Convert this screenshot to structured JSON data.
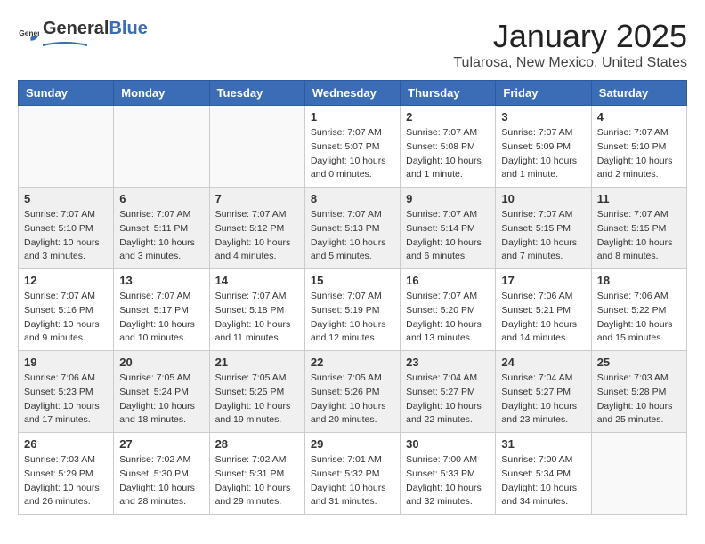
{
  "header": {
    "logo_general": "General",
    "logo_blue": "Blue",
    "month_title": "January 2025",
    "location": "Tularosa, New Mexico, United States"
  },
  "weekdays": [
    "Sunday",
    "Monday",
    "Tuesday",
    "Wednesday",
    "Thursday",
    "Friday",
    "Saturday"
  ],
  "weeks": [
    [
      {
        "day": "",
        "sunrise": "",
        "sunset": "",
        "daylight": ""
      },
      {
        "day": "",
        "sunrise": "",
        "sunset": "",
        "daylight": ""
      },
      {
        "day": "",
        "sunrise": "",
        "sunset": "",
        "daylight": ""
      },
      {
        "day": "1",
        "sunrise": "Sunrise: 7:07 AM",
        "sunset": "Sunset: 5:07 PM",
        "daylight": "Daylight: 10 hours and 0 minutes."
      },
      {
        "day": "2",
        "sunrise": "Sunrise: 7:07 AM",
        "sunset": "Sunset: 5:08 PM",
        "daylight": "Daylight: 10 hours and 1 minute."
      },
      {
        "day": "3",
        "sunrise": "Sunrise: 7:07 AM",
        "sunset": "Sunset: 5:09 PM",
        "daylight": "Daylight: 10 hours and 1 minute."
      },
      {
        "day": "4",
        "sunrise": "Sunrise: 7:07 AM",
        "sunset": "Sunset: 5:10 PM",
        "daylight": "Daylight: 10 hours and 2 minutes."
      }
    ],
    [
      {
        "day": "5",
        "sunrise": "Sunrise: 7:07 AM",
        "sunset": "Sunset: 5:10 PM",
        "daylight": "Daylight: 10 hours and 3 minutes."
      },
      {
        "day": "6",
        "sunrise": "Sunrise: 7:07 AM",
        "sunset": "Sunset: 5:11 PM",
        "daylight": "Daylight: 10 hours and 3 minutes."
      },
      {
        "day": "7",
        "sunrise": "Sunrise: 7:07 AM",
        "sunset": "Sunset: 5:12 PM",
        "daylight": "Daylight: 10 hours and 4 minutes."
      },
      {
        "day": "8",
        "sunrise": "Sunrise: 7:07 AM",
        "sunset": "Sunset: 5:13 PM",
        "daylight": "Daylight: 10 hours and 5 minutes."
      },
      {
        "day": "9",
        "sunrise": "Sunrise: 7:07 AM",
        "sunset": "Sunset: 5:14 PM",
        "daylight": "Daylight: 10 hours and 6 minutes."
      },
      {
        "day": "10",
        "sunrise": "Sunrise: 7:07 AM",
        "sunset": "Sunset: 5:15 PM",
        "daylight": "Daylight: 10 hours and 7 minutes."
      },
      {
        "day": "11",
        "sunrise": "Sunrise: 7:07 AM",
        "sunset": "Sunset: 5:15 PM",
        "daylight": "Daylight: 10 hours and 8 minutes."
      }
    ],
    [
      {
        "day": "12",
        "sunrise": "Sunrise: 7:07 AM",
        "sunset": "Sunset: 5:16 PM",
        "daylight": "Daylight: 10 hours and 9 minutes."
      },
      {
        "day": "13",
        "sunrise": "Sunrise: 7:07 AM",
        "sunset": "Sunset: 5:17 PM",
        "daylight": "Daylight: 10 hours and 10 minutes."
      },
      {
        "day": "14",
        "sunrise": "Sunrise: 7:07 AM",
        "sunset": "Sunset: 5:18 PM",
        "daylight": "Daylight: 10 hours and 11 minutes."
      },
      {
        "day": "15",
        "sunrise": "Sunrise: 7:07 AM",
        "sunset": "Sunset: 5:19 PM",
        "daylight": "Daylight: 10 hours and 12 minutes."
      },
      {
        "day": "16",
        "sunrise": "Sunrise: 7:07 AM",
        "sunset": "Sunset: 5:20 PM",
        "daylight": "Daylight: 10 hours and 13 minutes."
      },
      {
        "day": "17",
        "sunrise": "Sunrise: 7:06 AM",
        "sunset": "Sunset: 5:21 PM",
        "daylight": "Daylight: 10 hours and 14 minutes."
      },
      {
        "day": "18",
        "sunrise": "Sunrise: 7:06 AM",
        "sunset": "Sunset: 5:22 PM",
        "daylight": "Daylight: 10 hours and 15 minutes."
      }
    ],
    [
      {
        "day": "19",
        "sunrise": "Sunrise: 7:06 AM",
        "sunset": "Sunset: 5:23 PM",
        "daylight": "Daylight: 10 hours and 17 minutes."
      },
      {
        "day": "20",
        "sunrise": "Sunrise: 7:05 AM",
        "sunset": "Sunset: 5:24 PM",
        "daylight": "Daylight: 10 hours and 18 minutes."
      },
      {
        "day": "21",
        "sunrise": "Sunrise: 7:05 AM",
        "sunset": "Sunset: 5:25 PM",
        "daylight": "Daylight: 10 hours and 19 minutes."
      },
      {
        "day": "22",
        "sunrise": "Sunrise: 7:05 AM",
        "sunset": "Sunset: 5:26 PM",
        "daylight": "Daylight: 10 hours and 20 minutes."
      },
      {
        "day": "23",
        "sunrise": "Sunrise: 7:04 AM",
        "sunset": "Sunset: 5:27 PM",
        "daylight": "Daylight: 10 hours and 22 minutes."
      },
      {
        "day": "24",
        "sunrise": "Sunrise: 7:04 AM",
        "sunset": "Sunset: 5:27 PM",
        "daylight": "Daylight: 10 hours and 23 minutes."
      },
      {
        "day": "25",
        "sunrise": "Sunrise: 7:03 AM",
        "sunset": "Sunset: 5:28 PM",
        "daylight": "Daylight: 10 hours and 25 minutes."
      }
    ],
    [
      {
        "day": "26",
        "sunrise": "Sunrise: 7:03 AM",
        "sunset": "Sunset: 5:29 PM",
        "daylight": "Daylight: 10 hours and 26 minutes."
      },
      {
        "day": "27",
        "sunrise": "Sunrise: 7:02 AM",
        "sunset": "Sunset: 5:30 PM",
        "daylight": "Daylight: 10 hours and 28 minutes."
      },
      {
        "day": "28",
        "sunrise": "Sunrise: 7:02 AM",
        "sunset": "Sunset: 5:31 PM",
        "daylight": "Daylight: 10 hours and 29 minutes."
      },
      {
        "day": "29",
        "sunrise": "Sunrise: 7:01 AM",
        "sunset": "Sunset: 5:32 PM",
        "daylight": "Daylight: 10 hours and 31 minutes."
      },
      {
        "day": "30",
        "sunrise": "Sunrise: 7:00 AM",
        "sunset": "Sunset: 5:33 PM",
        "daylight": "Daylight: 10 hours and 32 minutes."
      },
      {
        "day": "31",
        "sunrise": "Sunrise: 7:00 AM",
        "sunset": "Sunset: 5:34 PM",
        "daylight": "Daylight: 10 hours and 34 minutes."
      },
      {
        "day": "",
        "sunrise": "",
        "sunset": "",
        "daylight": ""
      }
    ]
  ]
}
